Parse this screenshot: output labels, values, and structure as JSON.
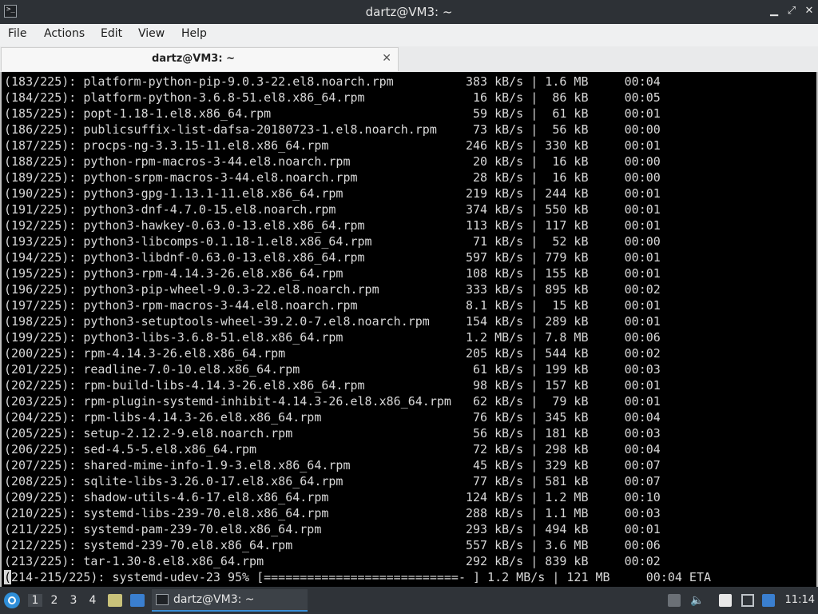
{
  "window": {
    "title": "dartz@VM3: ~"
  },
  "menu": [
    "File",
    "Actions",
    "Edit",
    "View",
    "Help"
  ],
  "tab": {
    "label": "dartz@VM3: ~"
  },
  "terminal_lines": [
    "(183/225): platform-python-pip-9.0.3-22.el8.noarch.rpm          383 kB/s | 1.6 MB     00:04",
    "(184/225): platform-python-3.6.8-51.el8.x86_64.rpm               16 kB/s |  86 kB     00:05",
    "(185/225): popt-1.18-1.el8.x86_64.rpm                            59 kB/s |  61 kB     00:01",
    "(186/225): publicsuffix-list-dafsa-20180723-1.el8.noarch.rpm     73 kB/s |  56 kB     00:00",
    "(187/225): procps-ng-3.3.15-11.el8.x86_64.rpm                   246 kB/s | 330 kB     00:01",
    "(188/225): python-rpm-macros-3-44.el8.noarch.rpm                 20 kB/s |  16 kB     00:00",
    "(189/225): python-srpm-macros-3-44.el8.noarch.rpm                28 kB/s |  16 kB     00:00",
    "(190/225): python3-gpg-1.13.1-11.el8.x86_64.rpm                 219 kB/s | 244 kB     00:01",
    "(191/225): python3-dnf-4.7.0-15.el8.noarch.rpm                  374 kB/s | 550 kB     00:01",
    "(192/225): python3-hawkey-0.63.0-13.el8.x86_64.rpm              113 kB/s | 117 kB     00:01",
    "(193/225): python3-libcomps-0.1.18-1.el8.x86_64.rpm              71 kB/s |  52 kB     00:00",
    "(194/225): python3-libdnf-0.63.0-13.el8.x86_64.rpm              597 kB/s | 779 kB     00:01",
    "(195/225): python3-rpm-4.14.3-26.el8.x86_64.rpm                 108 kB/s | 155 kB     00:01",
    "(196/225): python3-pip-wheel-9.0.3-22.el8.noarch.rpm            333 kB/s | 895 kB     00:02",
    "(197/225): python3-rpm-macros-3-44.el8.noarch.rpm               8.1 kB/s |  15 kB     00:01",
    "(198/225): python3-setuptools-wheel-39.2.0-7.el8.noarch.rpm     154 kB/s | 289 kB     00:01",
    "(199/225): python3-libs-3.6.8-51.el8.x86_64.rpm                 1.2 MB/s | 7.8 MB     00:06",
    "(200/225): rpm-4.14.3-26.el8.x86_64.rpm                         205 kB/s | 544 kB     00:02",
    "(201/225): readline-7.0-10.el8.x86_64.rpm                        61 kB/s | 199 kB     00:03",
    "(202/225): rpm-build-libs-4.14.3-26.el8.x86_64.rpm               98 kB/s | 157 kB     00:01",
    "(203/225): rpm-plugin-systemd-inhibit-4.14.3-26.el8.x86_64.rpm   62 kB/s |  79 kB     00:01",
    "(204/225): rpm-libs-4.14.3-26.el8.x86_64.rpm                     76 kB/s | 345 kB     00:04",
    "(205/225): setup-2.12.2-9.el8.noarch.rpm                         56 kB/s | 181 kB     00:03",
    "(206/225): sed-4.5-5.el8.x86_64.rpm                              72 kB/s | 298 kB     00:04",
    "(207/225): shared-mime-info-1.9-3.el8.x86_64.rpm                 45 kB/s | 329 kB     00:07",
    "(208/225): sqlite-libs-3.26.0-17.el8.x86_64.rpm                  77 kB/s | 581 kB     00:07",
    "(209/225): shadow-utils-4.6-17.el8.x86_64.rpm                   124 kB/s | 1.2 MB     00:10",
    "(210/225): systemd-libs-239-70.el8.x86_64.rpm                   288 kB/s | 1.1 MB     00:03",
    "(211/225): systemd-pam-239-70.el8.x86_64.rpm                    293 kB/s | 494 kB     00:01",
    "(212/225): systemd-239-70.el8.x86_64.rpm                        557 kB/s | 3.6 MB     00:06",
    "(213/225): tar-1.30-8.el8.x86_64.rpm                            292 kB/s | 839 kB     00:02"
  ],
  "progress_line": {
    "cursor_char": "(",
    "rest": "214-215/225): systemd-udev-23 95% [===========================- ] 1.2 MB/s | 121 MB     00:04 ETA"
  },
  "taskbar": {
    "workspaces": [
      "1",
      "2",
      "3",
      "4"
    ],
    "task_label": "dartz@VM3: ~",
    "clock": "11:14"
  }
}
